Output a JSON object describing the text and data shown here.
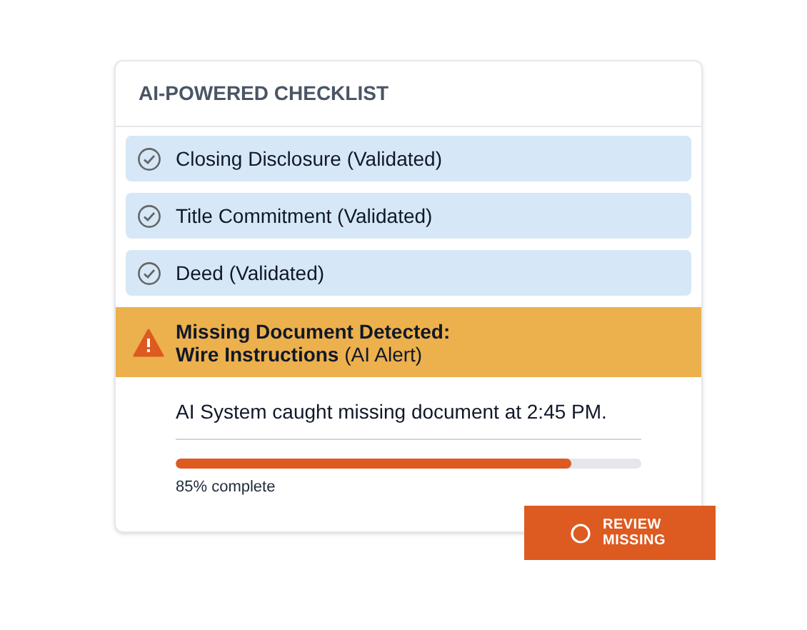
{
  "card": {
    "title": "AI-POWERED CHECKLIST"
  },
  "items": [
    {
      "label": "Closing Disclosure (Validated)",
      "checked": true
    },
    {
      "label": "Title Commitment (Validated)",
      "checked": true
    },
    {
      "label": "Deed (Validated)",
      "checked": true
    }
  ],
  "alert": {
    "title": "Missing Document Detected:",
    "detail": "**Wire Instructions** (AI Alert)"
  },
  "message": "AI System caught missing document at 2:45 PM.",
  "progress": {
    "level": 0.85,
    "reading": "85% complete"
  },
  "button": {
    "label": "REVIEW MISSING"
  }
}
